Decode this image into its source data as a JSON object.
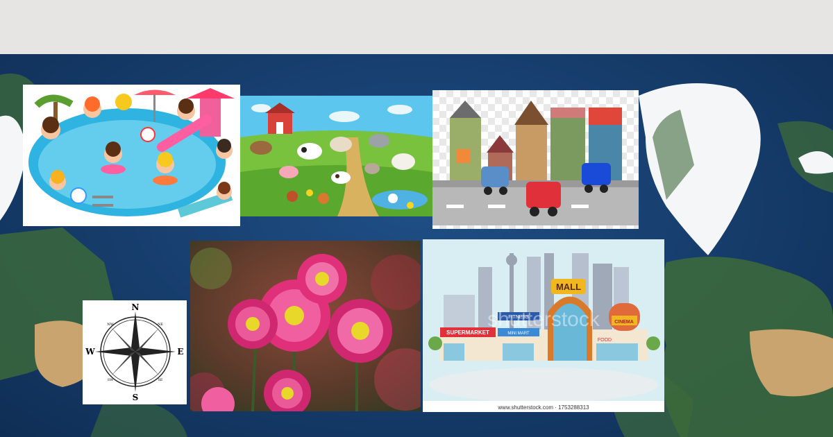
{
  "images": {
    "pool": {
      "icon": "swimming-pool-kids-icon"
    },
    "farm": {
      "icon": "farm-animals-icon"
    },
    "town": {
      "icon": "town-street-icon"
    },
    "compass": {
      "icon": "compass-rose-icon",
      "directions": {
        "north": "N",
        "south": "S",
        "east": "E",
        "west": "W",
        "ne": "NE",
        "nw": "NW",
        "se": "SE",
        "sw": "SW"
      }
    },
    "flower": {
      "icon": "pink-flowers-icon"
    },
    "mall": {
      "icon": "city-mall-icon",
      "labels": {
        "mall": "MALL",
        "cinema": "CINEMA",
        "supermarket": "SUPERMARKET",
        "fitness": "FITNESS",
        "minimart": "MINI MART",
        "food": "FOOD"
      },
      "watermark": "shutterstock",
      "credit": "www.shutterstock.com · 1753288313"
    }
  },
  "colors": {
    "top_bar": "#e6e5e3",
    "ocean": "#173f6f",
    "land_green": "#3d6b3a",
    "ice": "#f4f6f8",
    "desert": "#c9a46e"
  }
}
